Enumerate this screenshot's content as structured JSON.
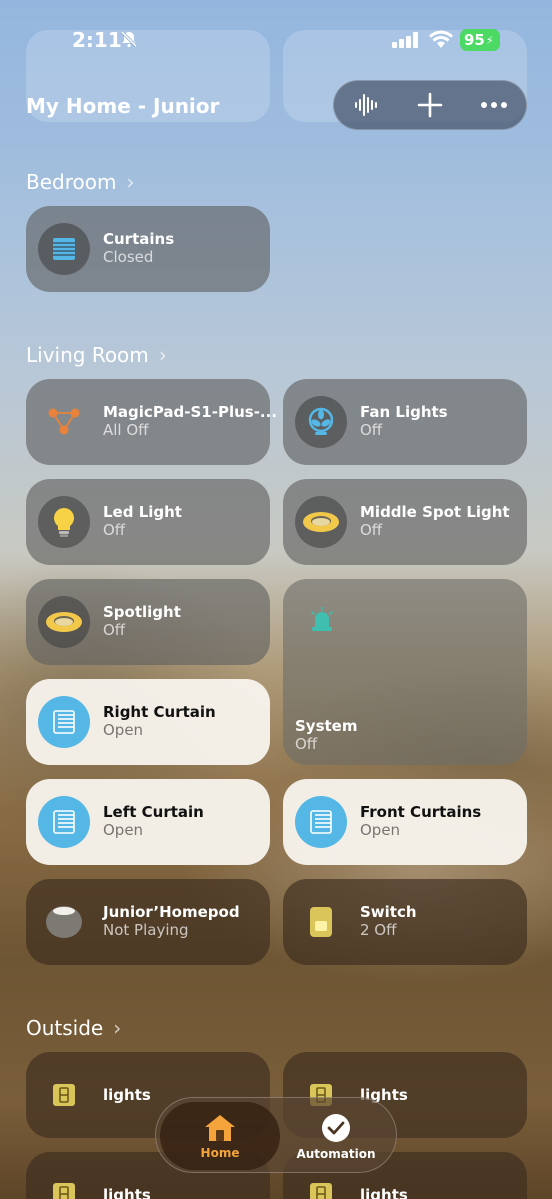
{
  "status": {
    "time": "2:11",
    "battery": "95"
  },
  "header": {
    "title": "My Home - Junior"
  },
  "sections": {
    "bedroom": "Bedroom",
    "living": "Living Room",
    "outside": "Outside"
  },
  "tiles": {
    "curtains": {
      "name": "Curtains",
      "status": "Closed"
    },
    "magicpad": {
      "name": "MagicPad-S1-Plus-...",
      "status": "All Off"
    },
    "fanlights": {
      "name": "Fan Lights",
      "status": "Off"
    },
    "ledlight": {
      "name": "Led Light",
      "status": "Off"
    },
    "middlespot": {
      "name": "Middle Spot Light",
      "status": "Off"
    },
    "spotlight": {
      "name": "Spotlight",
      "status": "Off"
    },
    "system": {
      "name": "System",
      "status": "Off"
    },
    "rightcurtain": {
      "name": "Right Curtain",
      "status": "Open"
    },
    "leftcurtain": {
      "name": "Left Curtain",
      "status": "Open"
    },
    "frontcurtains": {
      "name": "Front Curtains",
      "status": "Open"
    },
    "homepod": {
      "name": "Junior’Homepod",
      "status": "Not Playing"
    },
    "switch": {
      "name": "Switch",
      "status": "2 Off"
    },
    "outside1": {
      "name": "lights"
    },
    "outside2": {
      "name": "lights"
    },
    "outside3": {
      "name": "lights"
    },
    "outside4": {
      "name": "lights"
    }
  },
  "tabs": {
    "home": "Home",
    "automation": "Automation"
  },
  "colors": {
    "accent": "#f4a43a",
    "curtain_blue": "#55b7e6",
    "battery_green": "#4cd964"
  }
}
